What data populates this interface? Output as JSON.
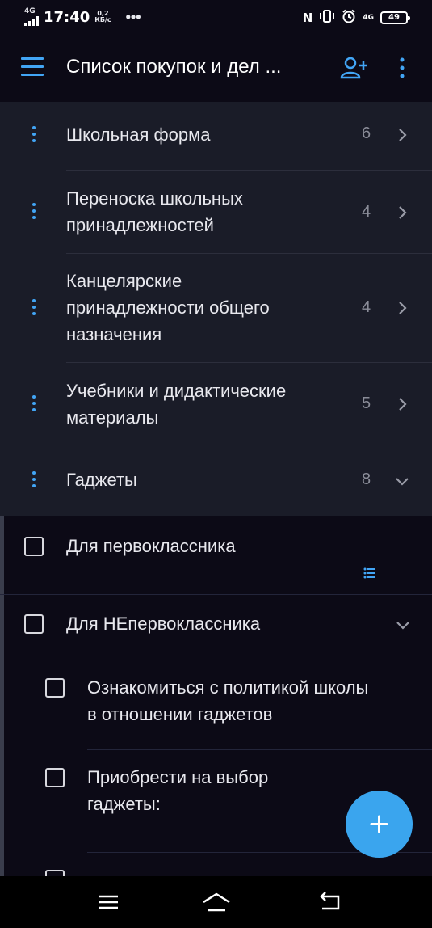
{
  "status_bar": {
    "network_left": "4G",
    "time": "17:40",
    "speed_value": "0,2",
    "speed_unit": "КБ/с",
    "network_right": "4G",
    "battery": "49"
  },
  "app_bar": {
    "title": "Список покупок и дел ..."
  },
  "lists": [
    {
      "name": "Школьная форма",
      "count": "6",
      "expanded": false
    },
    {
      "name": "Переноска школьных принадлежностей",
      "count": "4",
      "expanded": false
    },
    {
      "name": "Канцелярские принадлежности общего назначения",
      "count": "4",
      "expanded": false
    },
    {
      "name": "Учебники и дидактические материалы",
      "count": "5",
      "expanded": false
    },
    {
      "name": "Гаджеты",
      "count": "8",
      "expanded": true
    }
  ],
  "items": [
    {
      "text": "Для первоклассника",
      "checked": false,
      "has_notes": true
    },
    {
      "text": "Для НЕпервоклассника",
      "checked": false,
      "expanded": true
    },
    {
      "text": "Ознакомиться с политикой школы в отношении гаджетов",
      "checked": false,
      "level": 1
    },
    {
      "text": "Приобрести на выбор гаджеты:",
      "checked": false,
      "level": 1
    }
  ],
  "colors": {
    "accent": "#42a5f5",
    "fab": "#3aa5ee",
    "background": "#0c0a16",
    "list_panel": "#1a1c28"
  },
  "icons": {
    "menu": "hamburger-icon",
    "share": "add-person-icon",
    "more": "vertical-dots-icon",
    "fab": "plus-icon",
    "nav_menu": "menu-icon",
    "nav_home": "home-icon",
    "nav_back": "back-icon"
  }
}
